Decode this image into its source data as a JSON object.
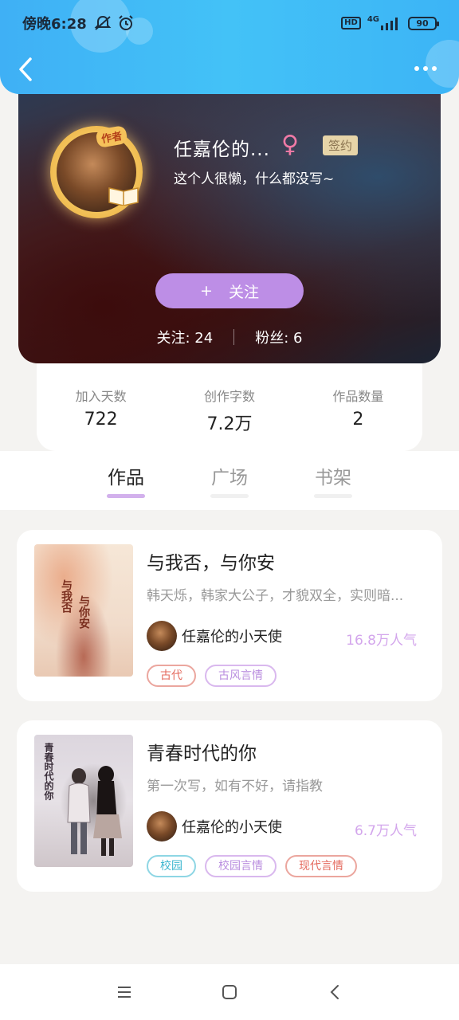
{
  "status_bar": {
    "time": "傍晚6:28",
    "network": "4G",
    "hd": "HD",
    "battery": "90"
  },
  "header": {
    "back_icon": "chevron-left-icon",
    "more_icon": "more-dots-icon"
  },
  "profile": {
    "author_badge": "作者",
    "name": "任嘉伦的...",
    "gender_symbol": "♀",
    "signed_badge": "签约",
    "bio": "这个人很懒，什么都没写~",
    "follow_plus": "+",
    "follow_label": "关注",
    "following_label": "关注: 24",
    "followers_label": "粉丝: 6"
  },
  "stats": [
    {
      "label": "加入天数",
      "value": "722"
    },
    {
      "label": "创作字数",
      "value": "7.2万"
    },
    {
      "label": "作品数量",
      "value": "2"
    }
  ],
  "tabs": [
    {
      "label": "作品",
      "active": true
    },
    {
      "label": "广场",
      "active": false
    },
    {
      "label": "书架",
      "active": false
    }
  ],
  "books": [
    {
      "title": "与我否，与你安",
      "description": "韩天烁，韩家大公子，才貌双全，实则暗...",
      "author": "任嘉伦的小天使",
      "popularity": "16.8万人气",
      "cover_text_a": "与我否",
      "cover_text_b": "与你安",
      "tags": [
        "古代",
        "古风言情"
      ]
    },
    {
      "title": "青春时代的你",
      "description": "第一次写，如有不好，请指教",
      "author": "任嘉伦的小天使",
      "popularity": "6.7万人气",
      "cover_text_a": "青春时代的你",
      "tags": [
        "校园",
        "校园言情",
        "现代言情"
      ]
    }
  ],
  "colors": {
    "header_blue": "#43c2f7",
    "follow_purple": "#bd8ee6",
    "popularity_purple": "#d3a6ec",
    "tag_red": "#e46a5e",
    "tag_purple": "#b98ddf",
    "tag_cyan": "#3bb6cf"
  }
}
